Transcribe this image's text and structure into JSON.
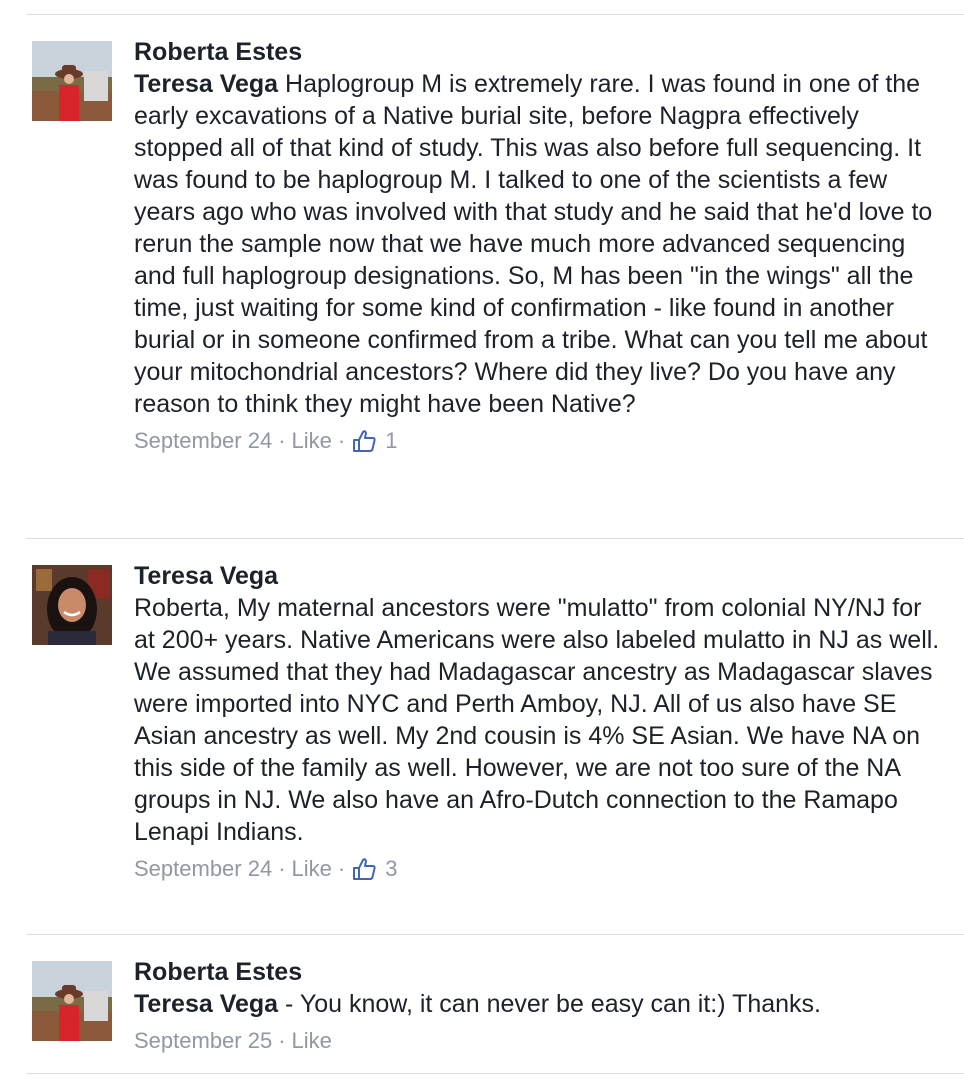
{
  "comments": [
    {
      "author": "Roberta Estes",
      "avatar_icon": "profile-photo-roberta-estes",
      "mention": "Teresa Vega",
      "text": "  Haplogroup M is extremely rare.  I was found in one of the early excavations of a Native burial site, before Nagpra effectively stopped all of that kind of study.  This was also before full sequencing.  It was found to be haplogroup M.  I talked to one of the scientists a few years ago who was involved with that study and he said that he'd love to rerun the sample now that we have much more advanced sequencing and full haplogroup designations.  So, M has been \"in the wings\" all the time, just waiting for some kind of confirmation - like found in another burial or in someone confirmed from a tribe.  What can you tell me about your mitochondrial ancestors?  Where did they live?  Do you have any reason to think they might have been Native?",
      "date": "September 24",
      "separator": "·",
      "like_label": "Like",
      "like_icon": "thumbs-up-icon",
      "like_count": "1"
    },
    {
      "author": "Teresa Vega",
      "avatar_icon": "profile-photo-teresa-vega",
      "text": "Roberta, My maternal ancestors were \"mulatto\" from colonial NY/NJ for at 200+ years. Native Americans were also labeled mulatto in NJ as well. We assumed that they had Madagascar ancestry as Madagascar slaves were imported into NYC and Perth Amboy, NJ. All of us also have SE Asian ancestry as well. My 2nd cousin is 4% SE Asian. We have NA on this side of the family as well. However, we are not too sure of the NA groups in NJ. We also have an Afro-Dutch connection to the Ramapo Lenapi Indians.",
      "date": "September 24",
      "separator": "·",
      "like_label": "Like",
      "like_icon": "thumbs-up-icon",
      "like_count": "3"
    },
    {
      "author": "Roberta Estes",
      "avatar_icon": "profile-photo-roberta-estes",
      "mention": "Teresa Vega",
      "text": " - You know, it can never be easy can it:)  Thanks.",
      "date": "September 25",
      "separator": "·",
      "like_label": "Like"
    }
  ],
  "colors": {
    "text": "#1d2129",
    "meta": "#9197a3",
    "divider": "#dcdee3",
    "like_icon": "#4267b2"
  }
}
